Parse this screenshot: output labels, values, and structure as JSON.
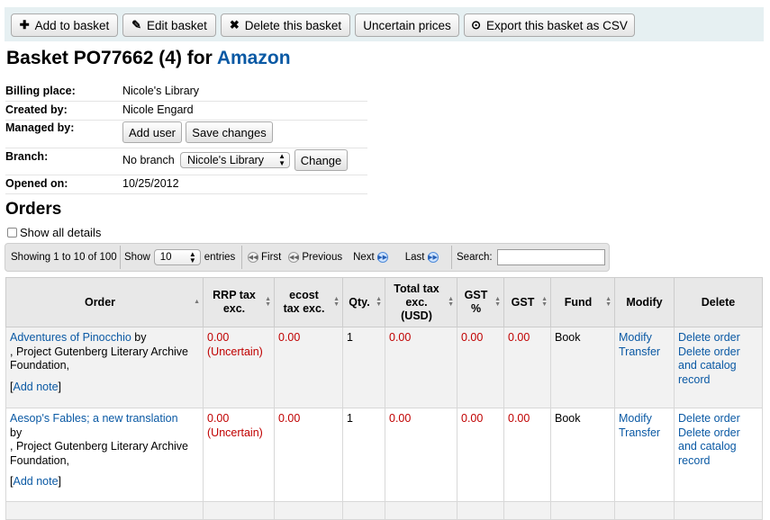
{
  "toolbar": {
    "add_to_basket": "Add to basket",
    "edit_basket": "Edit basket",
    "delete_basket": "Delete this basket",
    "uncertain_prices": "Uncertain prices",
    "export_csv": "Export this basket as CSV"
  },
  "title": {
    "prefix": "Basket PO77662 (4) for",
    "vendor": "Amazon"
  },
  "info": {
    "billing_label": "Billing place:",
    "billing_value": "Nicole's Library",
    "created_label": "Created by:",
    "created_value": "Nicole Engard",
    "managed_label": "Managed by:",
    "add_user": "Add user",
    "save_changes": "Save changes",
    "branch_label": "Branch:",
    "branch_value": "No branch",
    "branch_select": "Nicole's Library",
    "change": "Change",
    "opened_label": "Opened on:",
    "opened_value": "10/25/2012"
  },
  "orders_heading": "Orders",
  "show_all_details": "Show all details",
  "datatable": {
    "showing": "Showing 1 to 10 of 100",
    "show": "Show",
    "entries_value": "10",
    "entries": "entries",
    "first": "First",
    "previous": "Previous",
    "next": "Next",
    "last": "Last",
    "search": "Search:",
    "search_value": ""
  },
  "columns": {
    "order": "Order",
    "rrp_l1": "RRP tax",
    "rrp_l2": "exc.",
    "ecost_l1": "ecost",
    "ecost_l2": "tax exc.",
    "qty": "Qty.",
    "total_l1": "Total tax",
    "total_l2": "exc.",
    "total_l3": "(USD)",
    "gstp_l1": "GST",
    "gstp_l2": "%",
    "gst": "GST",
    "fund": "Fund",
    "modify": "Modify",
    "delete": "Delete"
  },
  "rows": [
    {
      "title": "Adventures of Pinocchio",
      "by": "by",
      "publisher": ", Project Gutenberg Literary Archive Foundation,",
      "add_note": "Add note",
      "rrp": "0.00",
      "rrp_note": "(Uncertain)",
      "ecost": "0.00",
      "qty": "1",
      "total": "0.00",
      "gst_pct": "0.00",
      "gst": "0.00",
      "fund": "Book",
      "modify": "Modify",
      "transfer": "Transfer",
      "delete_order": "Delete order",
      "delete_order_catalog": "Delete order and catalog record"
    },
    {
      "title": "Aesop's Fables; a new translation",
      "by": "by",
      "publisher": ", Project Gutenberg Literary Archive Foundation,",
      "add_note": "Add note",
      "rrp": "0.00",
      "rrp_note": "(Uncertain)",
      "ecost": "0.00",
      "qty": "1",
      "total": "0.00",
      "gst_pct": "0.00",
      "gst": "0.00",
      "fund": "Book",
      "modify": "Modify",
      "transfer": "Transfer",
      "delete_order": "Delete order",
      "delete_order_catalog": "Delete order and catalog record"
    }
  ]
}
